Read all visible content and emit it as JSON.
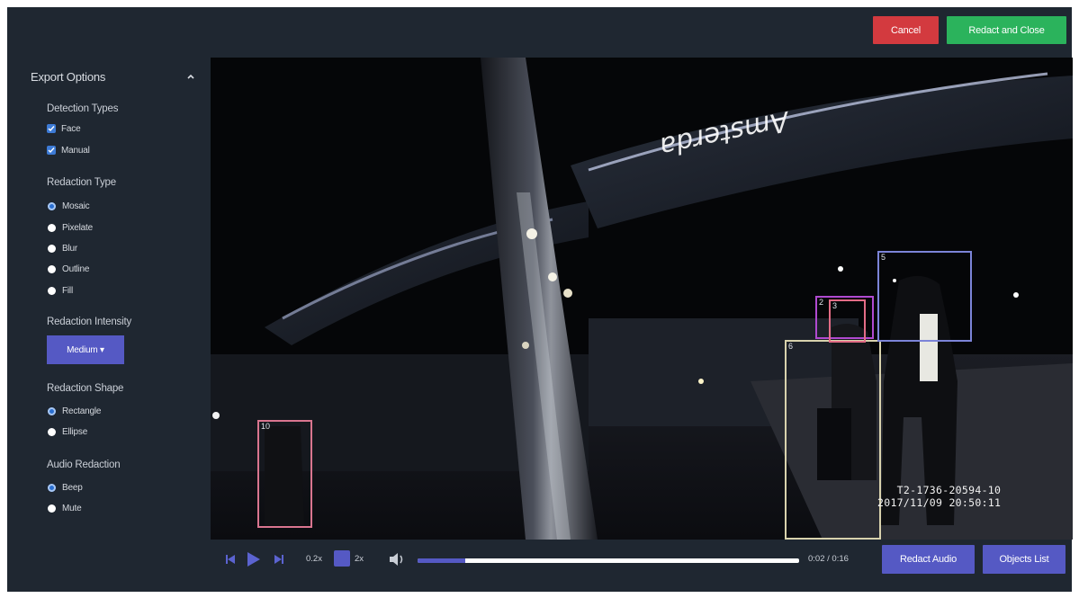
{
  "topbar": {
    "cancel_label": "Cancel",
    "redact_close_label": "Redact and Close"
  },
  "sidebar": {
    "title": "Export Options",
    "detection_types": {
      "title": "Detection Types",
      "items": [
        {
          "label": "Face",
          "checked": true
        },
        {
          "label": "Manual",
          "checked": true
        }
      ]
    },
    "redaction_type": {
      "title": "Redaction Type",
      "selected": "Mosaic",
      "items": [
        {
          "label": "Mosaic"
        },
        {
          "label": "Pixelate"
        },
        {
          "label": "Blur"
        },
        {
          "label": "Outline"
        },
        {
          "label": "Fill"
        }
      ]
    },
    "redaction_intensity": {
      "title": "Redaction Intensity",
      "value": "Medium ▾"
    },
    "redaction_shape": {
      "title": "Redaction Shape",
      "selected": "Rectangle",
      "items": [
        {
          "label": "Rectangle"
        },
        {
          "label": "Ellipse"
        }
      ]
    },
    "audio_redaction": {
      "title": "Audio Redaction",
      "selected": "Beep",
      "items": [
        {
          "label": "Beep"
        },
        {
          "label": "Mute"
        }
      ]
    }
  },
  "video": {
    "detections": [
      {
        "id": "10",
        "color": "#d9758f"
      },
      {
        "id": "6",
        "color": "#d8d2ad"
      },
      {
        "id": "2",
        "color": "#b04ad0"
      },
      {
        "id": "3",
        "color": "#e36c86"
      },
      {
        "id": "5",
        "color": "#7c84d8"
      }
    ],
    "overlay_line1": "T2-1736-20594-10",
    "overlay_line2": "2017/11/09 20:50:11",
    "sign_text": "Amsterda"
  },
  "controls": {
    "speed_min": "0.2x",
    "speed_max": "2x",
    "time": "0:02 / 0:16",
    "progress_fraction": 0.125,
    "redact_audio_label": "Redact Audio",
    "objects_list_label": "Objects List"
  },
  "colors": {
    "background": "#1f2731",
    "accent": "#5559c4",
    "cancel": "#d33a3f",
    "confirm": "#2bb35c",
    "checkbox": "#3d7bd6"
  }
}
